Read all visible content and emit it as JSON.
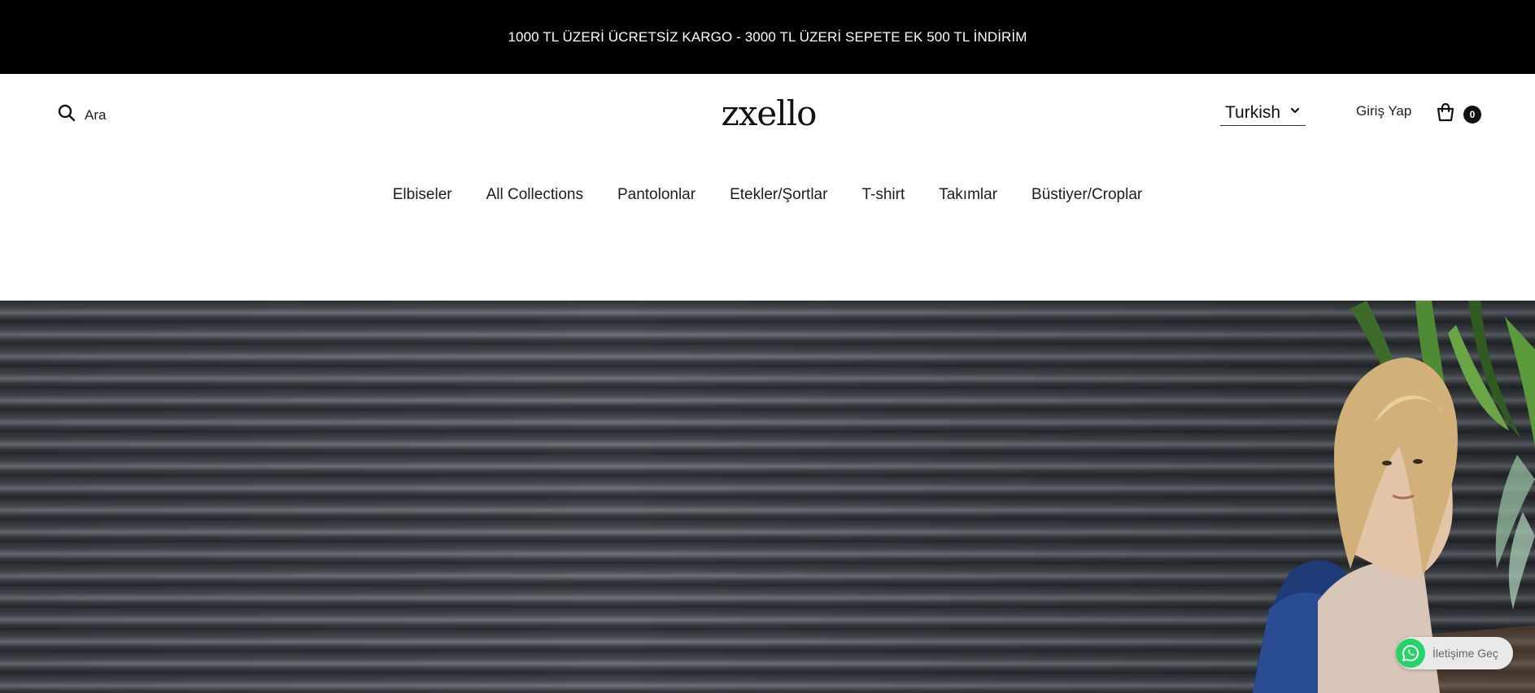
{
  "announcement": {
    "text": "1000 TL ÜZERİ ÜCRETSİZ KARGO - 3000 TL ÜZERİ SEPETE EK 500 TL İNDİRİM"
  },
  "header": {
    "search_label": "Ara",
    "logo_text": "zxello",
    "language": "Turkish",
    "login_label": "Giriş Yap",
    "cart_count": "0"
  },
  "nav": {
    "items": [
      {
        "label": "Elbiseler"
      },
      {
        "label": "All Collections"
      },
      {
        "label": "Pantolonlar"
      },
      {
        "label": "Etekler/Şortlar"
      },
      {
        "label": "T-shirt"
      },
      {
        "label": "Takımlar"
      },
      {
        "label": "Büstiyer/Croplar"
      }
    ]
  },
  "hero": {
    "image": "woman-seated-against-corrugated-metal-wall"
  },
  "whatsapp": {
    "label": "İletişime Geç",
    "icon": "whatsapp-icon"
  },
  "colors": {
    "announcement_bg": "#000000",
    "whatsapp_green": "#25d366"
  }
}
